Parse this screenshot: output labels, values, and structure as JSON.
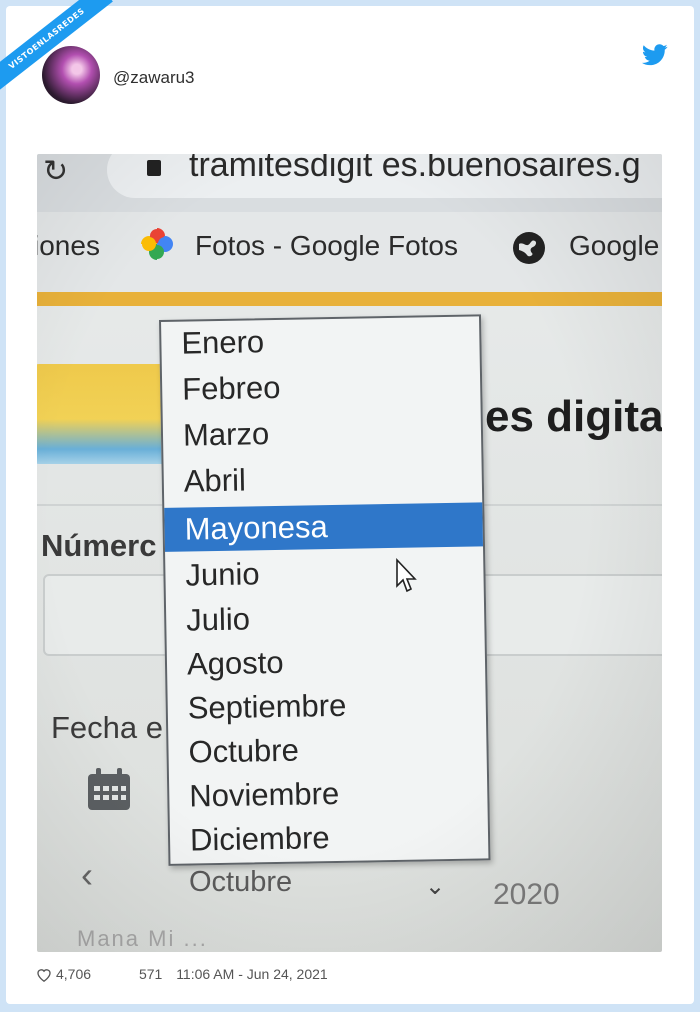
{
  "ribbon_text": "VISTOENLASREDES",
  "tweet": {
    "handle": "@zawaru3",
    "likes": "4,706",
    "retweets": "571",
    "timestamp": "11:06 AM - Jun 24, 2021",
    "brand_color": "#1d9bf0"
  },
  "photo": {
    "url": "tramitesdigit  es.buenosaires.g",
    "bookmarks": [
      "iones",
      "Fotos - Google Fotos",
      "Google"
    ],
    "site_title": "es digita",
    "field_label": "Númerc",
    "date_label": "Fecha e",
    "selected_month_field": "Octubre",
    "year": "2020",
    "weekday_row": "Mana  Mi  ..."
  },
  "dropdown": {
    "selected_index": 4,
    "highlight_color": "#2f77c9",
    "options": [
      "Enero",
      "Febreo",
      "Marzo",
      "Abril",
      "Mayonesa",
      "Junio",
      "Julio",
      "Agosto",
      "Septiembre",
      "Octubre",
      "Noviembre",
      "Diciembre"
    ]
  }
}
